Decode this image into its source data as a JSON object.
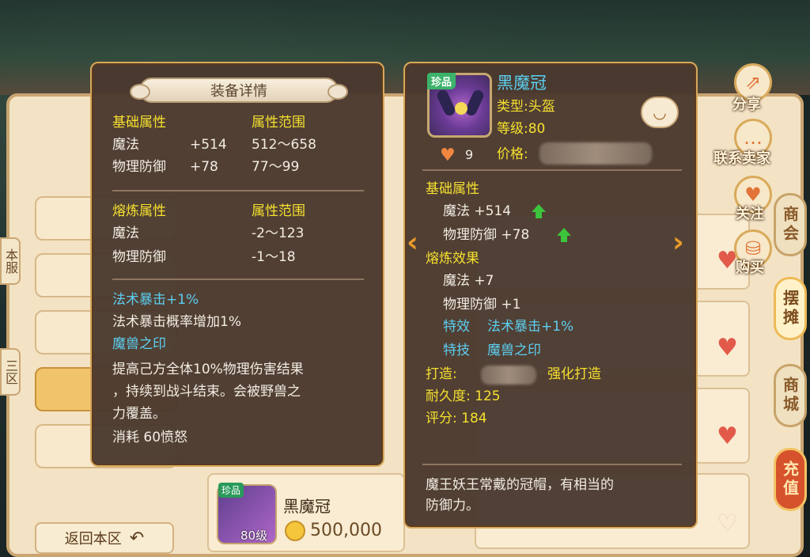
{
  "detail_panel": {
    "title": "装备详情",
    "base_header": "基础属性",
    "range_header": "属性范围",
    "base_stats": [
      {
        "name": "魔法",
        "value": "+514",
        "range": "512～658"
      },
      {
        "name": "物理防御",
        "value": "+78",
        "range": "77～99"
      }
    ],
    "smelt_header": "熔炼属性",
    "smelt_range_header": "属性范围",
    "smelt_stats": [
      {
        "name": "魔法",
        "range": "-2～123"
      },
      {
        "name": "物理防御",
        "range": "-1～18"
      }
    ],
    "effect1_title": "法术暴击+1%",
    "effect1_desc": "法术暴击概率增加1%",
    "effect2_title": "魔兽之印",
    "effect2_desc_1": "提高己方全体10%物理伤害结果",
    "effect2_desc_2": "，持续到战斗结束。会被野兽之",
    "effect2_desc_3": "力覆盖。",
    "effect2_cost": "消耗 60愤怒"
  },
  "item_panel": {
    "badge": "珍品",
    "name": "黑魔冠",
    "type": "类型:头盔",
    "level": "等级:80",
    "price_label": "价格:",
    "likes": "9",
    "base_header": "基础属性",
    "base_stats": [
      {
        "text": "魔法 +514"
      },
      {
        "text": "物理防御 +78"
      }
    ],
    "smelt_header": "熔炼效果",
    "smelt_stats": [
      {
        "text": "魔法 +7"
      },
      {
        "text": "物理防御 +1"
      }
    ],
    "special_effect_label": "特效",
    "special_effect_value": "法术暴击+1%",
    "special_skill_label": "特技",
    "special_skill_value": "魔兽之印",
    "forge_label": "打造:",
    "forge_tag": "强化打造",
    "durability": "耐久度: 125",
    "score": "评分: 184",
    "description_1": "魔王妖王常戴的冠帽，有相当的",
    "description_2": "防御力。"
  },
  "float_actions": {
    "share": "分享",
    "contact": "联系卖家",
    "follow": "关注",
    "buy": "购买"
  },
  "right_tabs": [
    "商会",
    "摆摊",
    "商城",
    "充值"
  ],
  "left_tabs": [
    "本服",
    "三区"
  ],
  "background": {
    "back_button": "返回本区",
    "bottom_item_badge": "珍品",
    "bottom_item_name": "黑魔冠",
    "bottom_item_level": "80级",
    "bottom_item_price": "500,000"
  },
  "colors": {
    "header_yellow": "#f5e02e",
    "effect_cyan": "#5ccff0",
    "panel_bg": "#4a382e",
    "panel_border": "#d7a85b"
  }
}
